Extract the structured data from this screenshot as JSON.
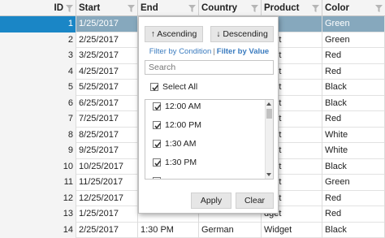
{
  "columns": [
    "ID",
    "Start",
    "End",
    "Country",
    "Product",
    "Color"
  ],
  "rows": [
    {
      "id": "1",
      "start": "1/25/2017",
      "end": "",
      "country": "",
      "product": "",
      "color": "Green"
    },
    {
      "id": "2",
      "start": "2/25/2017",
      "end": "",
      "country": "",
      "product": "dget",
      "color": "Green"
    },
    {
      "id": "3",
      "start": "3/25/2017",
      "end": "",
      "country": "",
      "product": "dget",
      "color": "Red"
    },
    {
      "id": "4",
      "start": "4/25/2017",
      "end": "",
      "country": "",
      "product": "dget",
      "color": "Red"
    },
    {
      "id": "5",
      "start": "5/25/2017",
      "end": "",
      "country": "",
      "product": "dget",
      "color": "Black"
    },
    {
      "id": "6",
      "start": "6/25/2017",
      "end": "",
      "country": "",
      "product": "dget",
      "color": "Black"
    },
    {
      "id": "7",
      "start": "7/25/2017",
      "end": "",
      "country": "",
      "product": "dget",
      "color": "Red"
    },
    {
      "id": "8",
      "start": "8/25/2017",
      "end": "",
      "country": "",
      "product": "dget",
      "color": "White"
    },
    {
      "id": "9",
      "start": "9/25/2017",
      "end": "",
      "country": "",
      "product": "dget",
      "color": "White"
    },
    {
      "id": "10",
      "start": "10/25/2017",
      "end": "",
      "country": "",
      "product": "dget",
      "color": "Black"
    },
    {
      "id": "11",
      "start": "11/25/2017",
      "end": "",
      "country": "",
      "product": "dget",
      "color": "Green"
    },
    {
      "id": "12",
      "start": "12/25/2017",
      "end": "",
      "country": "",
      "product": "dget",
      "color": "Red"
    },
    {
      "id": "13",
      "start": "1/25/2017",
      "end": "",
      "country": "",
      "product": "dget",
      "color": "Red"
    },
    {
      "id": "14",
      "start": "2/25/2017",
      "end": "1:30 PM",
      "country": "German",
      "product": "Widget",
      "color": "Black"
    }
  ],
  "filter": {
    "ascending": "↑ Ascending",
    "descending": "↓ Descending",
    "by_condition": "Filter by Condition",
    "separator": "|",
    "by_value": "Filter by Value",
    "search_placeholder": "Search",
    "select_all": "Select All",
    "values": [
      {
        "label": "12:00 AM",
        "checked": true
      },
      {
        "label": "12:00 PM",
        "checked": true
      },
      {
        "label": "1:30 AM",
        "checked": true
      },
      {
        "label": "1:30 PM",
        "checked": true
      }
    ],
    "apply": "Apply",
    "clear": "Clear"
  },
  "colors": {
    "selected_row": "#86a8bd",
    "selected_id": "#1a86c6",
    "link": "#3a7bbf"
  },
  "icons": {
    "header_filter": "funnel-icon",
    "check": "checkmark-icon"
  }
}
